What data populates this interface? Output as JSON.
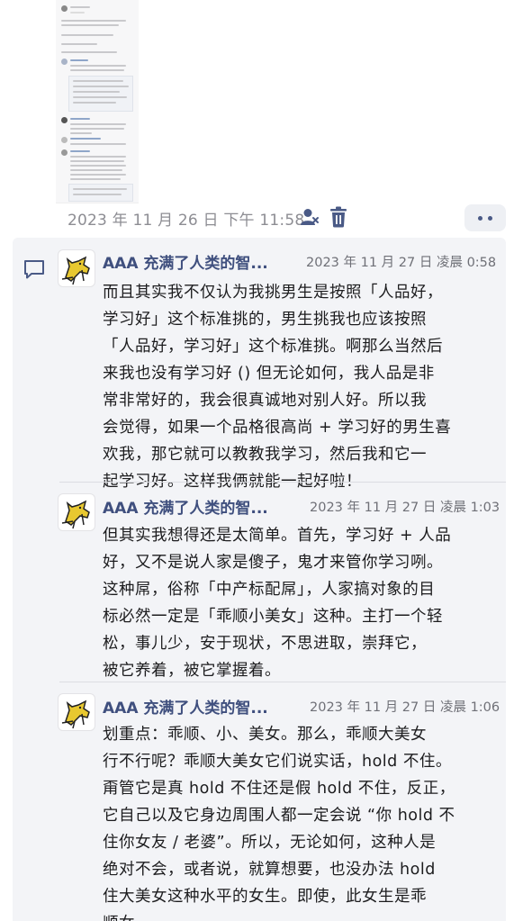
{
  "top": {
    "timestamp": "2023 年 11 月 26 日 下午 11:58"
  },
  "posts": [
    {
      "author": "AAA 充满了人类的智...",
      "time": "2023 年 11 月 27 日 凌晨 0:58",
      "text": "而且其实我不仅认为我挑男生是按照「人品好，\n学习好」这个标准挑的，男生挑我也应该按照\n「人品好，学习好」这个标准挑。啊那么当然后\n来我也没有学习好 () 但无论如何，我人品是非\n常非常好的，我会很真诚地对别人好。所以我\n会觉得，如果一个品格很高尚 + 学习好的男生喜\n欢我，那它就可以教教我学习，然后我和它一\n起学习好。这样我俩就能一起好啦！"
    },
    {
      "author": "AAA 充满了人类的智...",
      "time": "2023 年 11 月 27 日 凌晨 1:03",
      "text": "但其实我想得还是太简单。首先，学习好 + 人品\n好，又不是说人家是傻子，鬼才来管你学习咧。\n这种屌，俗称「中产标配屌」，人家搞对象的目\n标必然一定是「乖顺小美女」这种。主打一个轻\n松，事儿少，安于现状，不思进取，崇拜它，\n被它养着，被它掌握着。"
    },
    {
      "author": "AAA 充满了人类的智...",
      "time": "2023 年 11 月 27 日 凌晨 1:06",
      "text": "划重点：乖顺、小、美女。那么，乖顺大美女\n行不行呢？乖顺大美女它们说实话，hold 不住。\n甭管它是真 hold 不住还是假 hold 不住，反正，\n它自己以及它身边周围人都一定会说 “你 hold 不\n住你女友 / 老婆”。所以，无论如何，这种人是\n绝对不会，或者说，就算想要，也没办法 hold\n住大美女这种水平的女生。即使，此女生是乖\n顺女。"
    }
  ],
  "colors": {
    "author": "#3f4f7e",
    "accent": "#3f4f7e",
    "panel_bg": "#f3f4f7"
  },
  "icons": [
    "user-icon",
    "trash-icon",
    "more-icon",
    "comment-icon",
    "dog-avatar"
  ]
}
